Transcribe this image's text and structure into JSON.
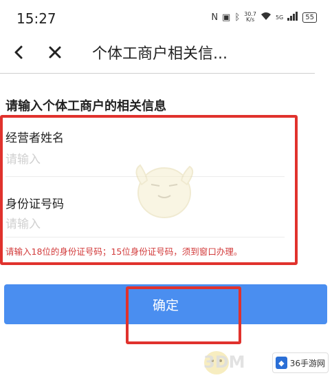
{
  "status_bar": {
    "time": "15:27",
    "net_speed_value": "30.7",
    "net_speed_unit": "K/s",
    "signal_label": "5G",
    "battery": "55"
  },
  "nav": {
    "title": "个体工商户相关信..."
  },
  "form": {
    "heading": "请输入个体工商户的相关信息",
    "fields": [
      {
        "label": "经营者姓名",
        "placeholder": "请输入",
        "value": ""
      },
      {
        "label": "身份证号码",
        "placeholder": "请输入",
        "value": ""
      }
    ],
    "hint": "请输入18位的身份证号码；15位身份证号码，须到窗口办理。"
  },
  "actions": {
    "confirm_label": "确定"
  },
  "watermarks": {
    "logo_text": "3DM",
    "site_name": "36手游网"
  },
  "colors": {
    "primary": "#4a8ef0",
    "highlight_box": "#e0322d",
    "hint_text": "#d23a3a"
  }
}
